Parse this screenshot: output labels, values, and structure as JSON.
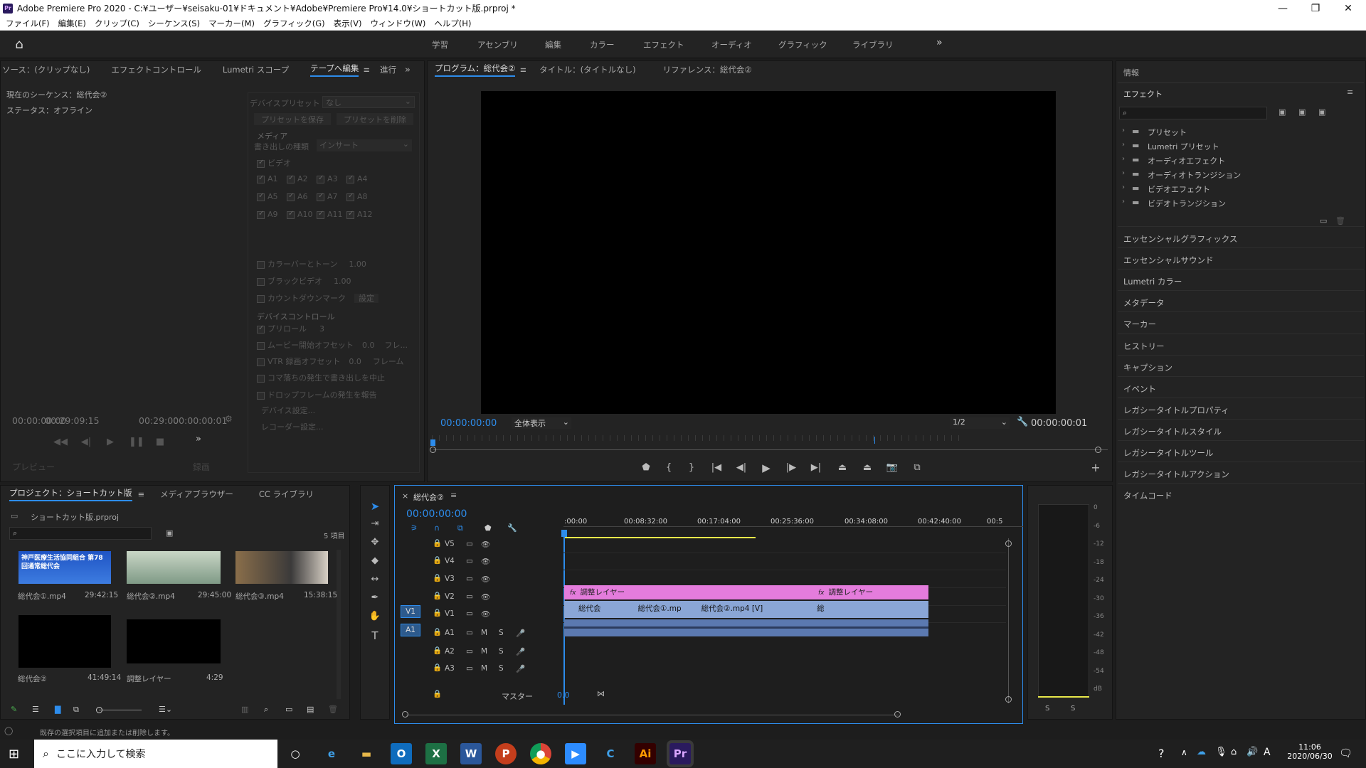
{
  "app": {
    "title": "Adobe Premiere Pro 2020 - C:¥ユーザー¥seisaku-01¥ドキュメント¥Adobe¥Premiere Pro¥14.0¥ショートカット版.prproj *",
    "icon": "Pr"
  },
  "menu": [
    "ファイル(F)",
    "編集(E)",
    "クリップ(C)",
    "シーケンス(S)",
    "マーカー(M)",
    "グラフィック(G)",
    "表示(V)",
    "ウィンドウ(W)",
    "ヘルプ(H)"
  ],
  "workspaces": [
    "学習",
    "アセンブリ",
    "編集",
    "カラー",
    "エフェクト",
    "オーディオ",
    "グラフィック",
    "ライブラリ"
  ],
  "source_panel": {
    "tabs": [
      "ソース：(クリップなし)",
      "エフェクトコントロール",
      "Lumetri スコープ",
      "テープへ編集",
      "進行"
    ],
    "current_sequence": "現在のシーケンス：総代会②",
    "status": "ステータス：オフライン",
    "device_preset_label": "デバイスプリセット",
    "device_preset_value": "なし",
    "save_preset": "プリセットを保存",
    "delete_preset": "プリセットを削除",
    "media_header": "メディア",
    "overwrite_label": "書き出しの種類",
    "overwrite_value": "インサート",
    "video": "ビデオ",
    "audio_tracks": [
      "A1",
      "A2",
      "A3",
      "A4",
      "A5",
      "A6",
      "A7",
      "A8",
      "A9",
      "A10",
      "A11",
      "A12"
    ],
    "color_bars": "カラーバーとトーン",
    "color_bars_val": "1.00",
    "black_video": "ブラックビデオ",
    "black_video_val": "1.00",
    "countdown": "カウントダウンマーク",
    "countdown_btn": "設定",
    "device_control_header": "デバイスコントロール",
    "preroll": "プリロール",
    "preroll_val": "3",
    "movie_offset": "ムービー開始オフセット",
    "movie_offset_val": "0.0",
    "movie_offset_unit": "フレ...",
    "vtr_offset": "VTR 録画オフセット",
    "vtr_offset_val": "0.0",
    "vtr_offset_unit": "フレーム",
    "abort_dropped": "コマ落ちの発生で書き出しを中止",
    "report_dropped": "ドロップフレームの発生を報告",
    "device_settings": "デバイス設定...",
    "recorder_settings": "レコーダー設定...",
    "tc_left": "00:00:00:00",
    "tc_left2": "00:29:09:15",
    "tc_right": "00:29:00",
    "tc_right2": "00:00:00:01",
    "preview_btn": "プレビュー",
    "record_btn": "録画"
  },
  "program_panel": {
    "tabs": [
      "プログラム：総代会②",
      "タイトル：(タイトルなし)",
      "リファレンス：総代会②"
    ],
    "timecode": "00:00:00:00",
    "fit": "全体表示",
    "quality": "1/2",
    "duration": "00:00:00:01"
  },
  "project_panel": {
    "tabs": [
      "プロジェクト：ショートカット版",
      "メディアブラウザー",
      "CC ライブラリ"
    ],
    "file": "ショートカット版.prproj",
    "count": "5 項目",
    "items": [
      {
        "name": "総代会①.mp4",
        "duration": "29:42:15",
        "thumb_text": "神戸医療生活協同組合 第78回通常総代会"
      },
      {
        "name": "総代会②.mp4",
        "duration": "29:45:00"
      },
      {
        "name": "総代会③.mp4",
        "duration": "15:38:15"
      },
      {
        "name": "総代会②",
        "duration": "41:49:14"
      },
      {
        "name": "調整レイヤー",
        "duration": "4:29"
      }
    ]
  },
  "timeline": {
    "sequence_tab": "総代会②",
    "timecode": "00:00:00:00",
    "ruler": [
      ":00:00",
      "00:08:32:00",
      "00:17:04:00",
      "00:25:36:00",
      "00:34:08:00",
      "00:42:40:00",
      "00:5"
    ],
    "video_tracks": [
      "V5",
      "V4",
      "V3",
      "V2",
      "V1"
    ],
    "audio_tracks": [
      "A1",
      "A2",
      "A3"
    ],
    "master": "マスター",
    "master_val": "0.0",
    "src_v": "V1",
    "src_a": "A1",
    "adj_layer": "調整レイヤー",
    "clip1": "総代会",
    "clip2": "総代会①.mp",
    "clip3": "総代会②.mp4 [V]",
    "clip4": "総"
  },
  "meter": {
    "scale": [
      "0",
      "-6",
      "-12",
      "-18",
      "-24",
      "-30",
      "-36",
      "-42",
      "-48",
      "-54",
      "dB"
    ],
    "solo": [
      "S",
      "S"
    ]
  },
  "right_panel": {
    "info_tab": "情報",
    "effects_tab": "エフェクト",
    "effect_folders": [
      "プリセット",
      "Lumetri プリセット",
      "オーディオエフェクト",
      "オーディオトランジション",
      "ビデオエフェクト",
      "ビデオトランジション"
    ],
    "sections": [
      "エッセンシャルグラフィックス",
      "エッセンシャルサウンド",
      "Lumetri カラー",
      "メタデータ",
      "マーカー",
      "ヒストリー",
      "キャプション",
      "イベント",
      "レガシータイトルプロパティ",
      "レガシータイトルスタイル",
      "レガシータイトルツール",
      "レガシータイトルアクション",
      "タイムコード"
    ]
  },
  "status_bar": "既存の選択項目に追加または削除します。",
  "taskbar": {
    "search": "ここに入力して検索",
    "time": "11:06",
    "date": "2020/06/30"
  },
  "colors": {
    "accent": "#2d8ceb",
    "adjustment": "#e47cdc",
    "clip": "#8aa6d6",
    "timecode": "#2d8ceb"
  }
}
